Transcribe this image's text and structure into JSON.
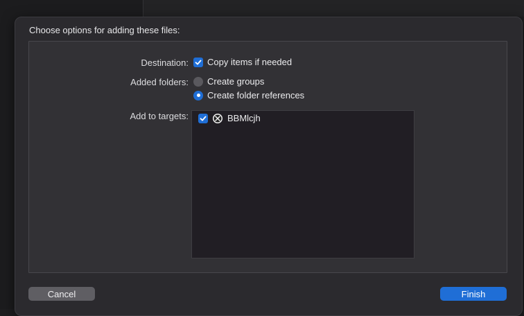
{
  "dialog": {
    "title": "Choose options for adding these files:",
    "destination": {
      "label": "Destination:",
      "option_label": "Copy items if needed",
      "checked": true
    },
    "added_folders": {
      "label": "Added folders:",
      "options": [
        {
          "label": "Create groups",
          "selected": false
        },
        {
          "label": "Create folder references",
          "selected": true
        }
      ]
    },
    "targets": {
      "label": "Add to targets:",
      "items": [
        {
          "name": "BBMlcjh",
          "checked": true,
          "icon": "app-target-icon"
        }
      ]
    },
    "buttons": {
      "cancel": "Cancel",
      "finish": "Finish"
    },
    "colors": {
      "accent": "#1f6ed6",
      "sheet_bg": "#2b2a2e",
      "group_bg": "#323135"
    }
  }
}
